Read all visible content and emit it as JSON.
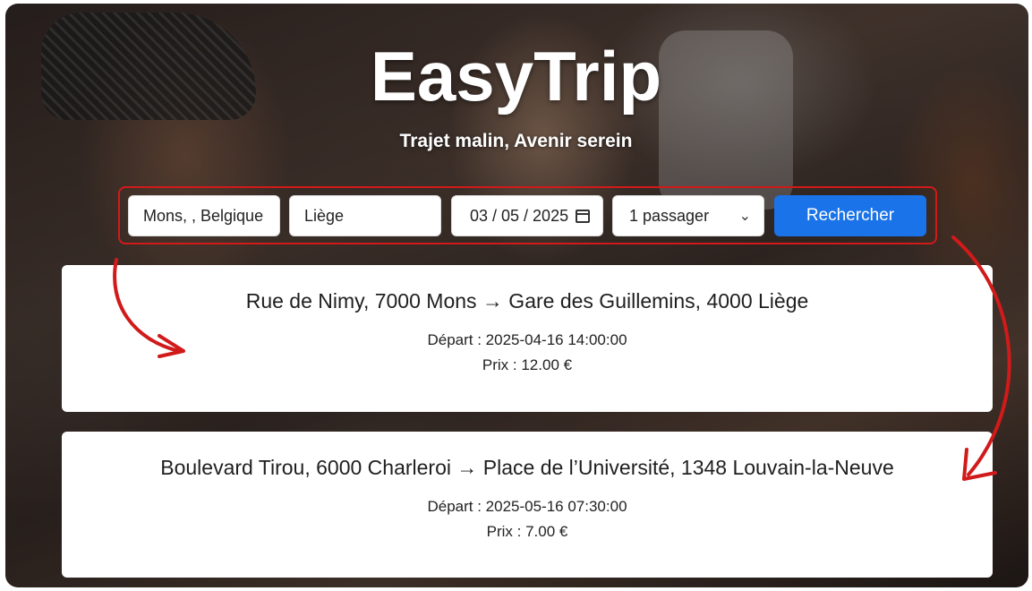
{
  "brand": {
    "title": "EasyTrip",
    "tagline": "Trajet malin, Avenir serein"
  },
  "search": {
    "from_value": "Mons,  , Belgique",
    "to_value": "Liège",
    "date_value": "03 / 05 / 2025",
    "passengers_value": "1 passager",
    "submit_label": "Rechercher"
  },
  "results": [
    {
      "route": "Rue de Nimy, 7000 Mons → Gare des Guillemins, 4000 Liège",
      "departure": "Départ : 2025-04-16 14:00:00",
      "price": "Prix : 12.00 €"
    },
    {
      "route": "Boulevard Tirou, 6000 Charleroi → Place de l’Université, 1348 Louvain-la-Neuve",
      "departure": "Départ : 2025-05-16 07:30:00",
      "price": "Prix : 7.00 €"
    }
  ],
  "colors": {
    "accent": "#1a73e8",
    "highlight": "#d11a1a"
  },
  "icons": [
    "calendar-icon",
    "chevron-down-icon"
  ]
}
